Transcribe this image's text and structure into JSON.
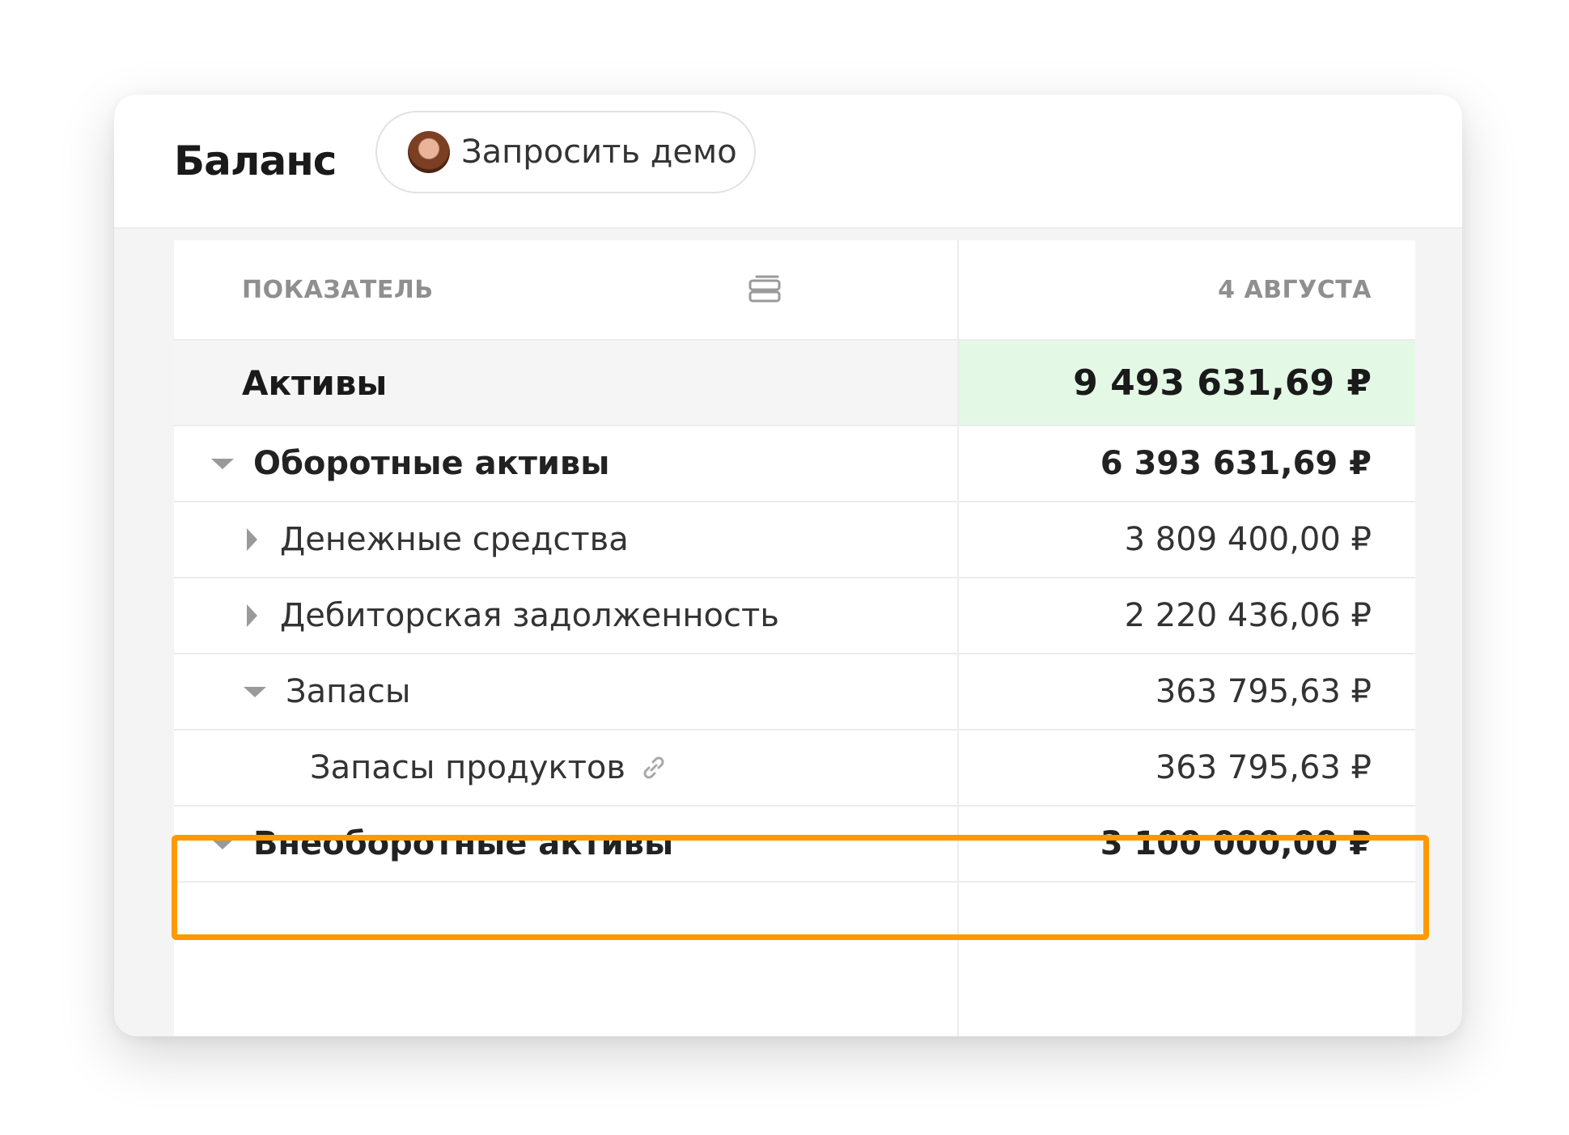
{
  "header": {
    "title": "Баланс",
    "demo_button_label": "Запросить демо",
    "avatar_icon": "user-avatar"
  },
  "table": {
    "column_indicator": "ПОКАЗАТЕЛЬ",
    "column_date": "4 АВГУСТА",
    "column_settings_icon": "columns-icon",
    "rows": [
      {
        "label": "Активы",
        "value": "9 493 631,69 ₽",
        "level": 0,
        "style": "total",
        "highlight_color": "#e3f9e5"
      },
      {
        "label": "Оборотные активы",
        "value": "6 393 631,69 ₽",
        "level": 1,
        "style": "bold",
        "expander": "expanded"
      },
      {
        "label": "Денежные средства",
        "value": "3 809 400,00 ₽",
        "level": 2,
        "style": "normal",
        "expander": "collapsed"
      },
      {
        "label": "Дебиторская задолженность",
        "value": "2 220 436,06 ₽",
        "level": 2,
        "style": "normal",
        "expander": "collapsed"
      },
      {
        "label": "Запасы",
        "value": "363 795,63 ₽",
        "level": 2,
        "style": "normal",
        "expander": "expanded"
      },
      {
        "label": "Запасы продуктов",
        "value": "363 795,63 ₽",
        "level": 3,
        "style": "normal",
        "link_icon": "link-icon",
        "highlighted": true
      },
      {
        "label": "Внеоборотные активы",
        "value": "3 100 000,00 ₽",
        "level": 1,
        "style": "bold",
        "expander": "expanded"
      }
    ]
  },
  "colors": {
    "highlight_frame": "#ff9900",
    "total_value_background": "#e3f9e5",
    "total_label_background": "#f5f5f5"
  }
}
